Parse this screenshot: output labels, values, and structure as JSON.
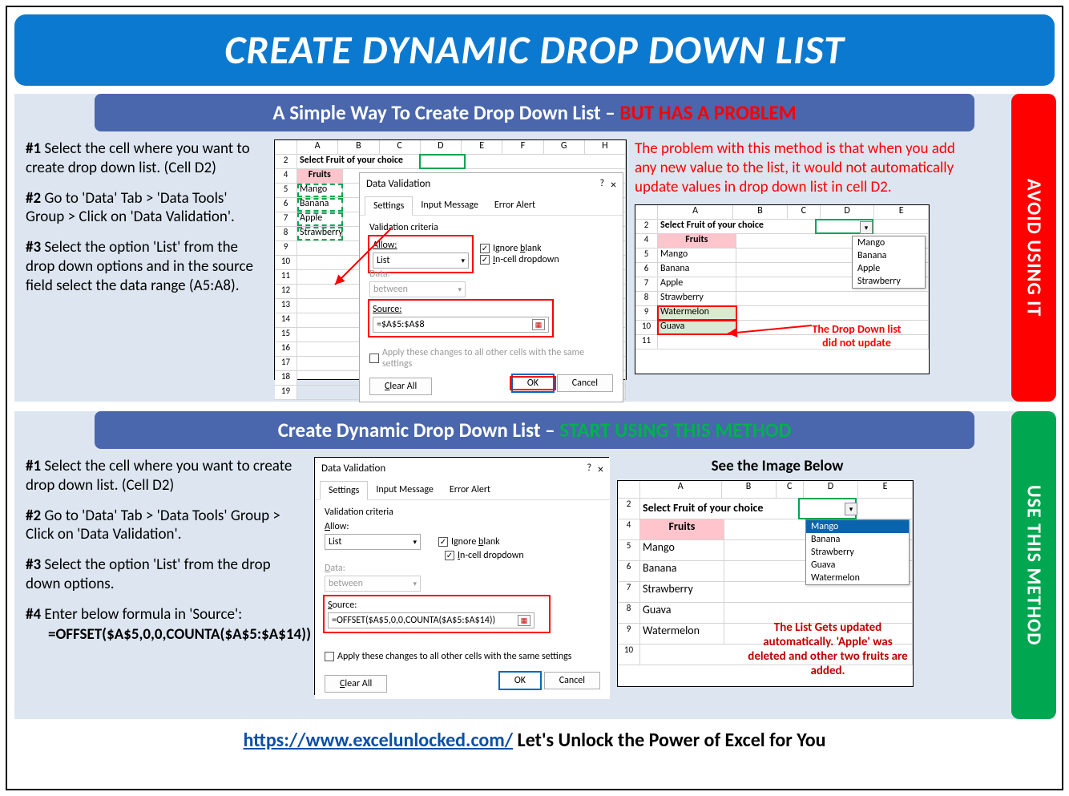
{
  "title": "CREATE DYNAMIC DROP DOWN LIST",
  "section1": {
    "head_a": "A Simple Way To Create Drop Down List – ",
    "head_b": "BUT HAS A PROBLEM",
    "side": "AVOID USING IT",
    "steps": {
      "s1a": "#1",
      "s1b": " Select the cell where you want to create drop down list. (Cell D2)",
      "s2a": "#2",
      "s2b": " Go to 'Data' Tab > 'Data Tools' Group > Click on 'Data Validation'.",
      "s3a": "#3",
      "s3b": " Select the option 'List' from the drop down options and in the source field select the data range (A5:A8)."
    },
    "sheet": {
      "cols": [
        "A",
        "B",
        "C",
        "D",
        "E",
        "F",
        "G",
        "H"
      ],
      "label_row": "2",
      "label": "Select Fruit of your choice",
      "header": "Fruits",
      "items": [
        "Mango",
        "Banana",
        "Apple",
        "Strawberry"
      ]
    },
    "dialog": {
      "title": "Data Validation",
      "tabs": [
        "Settings",
        "Input Message",
        "Error Alert"
      ],
      "criteria_label": "Validation criteria",
      "allow": "Allow:",
      "allow_val": "List",
      "data": "Data:",
      "data_val": "between",
      "source": "Source:",
      "source_val": "=$A$5:$A$8",
      "ignore": "Ignore blank",
      "incell": "In-cell dropdown",
      "apply": "Apply these changes to all other cells with the same settings",
      "clear": "Clear All",
      "ok": "OK",
      "cancel": "Cancel"
    },
    "problem": "The problem with this method is that when you add any new value to the list, it would not automatically update values in drop down list in cell D2.",
    "result": {
      "cols": [
        "A",
        "B",
        "C",
        "D",
        "E"
      ],
      "label": "Select Fruit of your choice",
      "header": "Fruits",
      "items": [
        "Mango",
        "Banana",
        "Apple",
        "Strawberry",
        "Watermelon",
        "Guava"
      ],
      "dd": [
        "Mango",
        "Banana",
        "Apple",
        "Strawberry"
      ],
      "callout1": "The Drop Down list",
      "callout2": "did not update"
    }
  },
  "section2": {
    "head_a": "Create Dynamic Drop Down List – ",
    "head_b": "START USING THIS METHOD",
    "side": "USE THIS METHOD",
    "steps": {
      "s1a": "#1",
      "s1b": " Select the cell where you want to create drop down list. (Cell D2)",
      "s2a": "#2",
      "s2b": " Go to 'Data' Tab > 'Data Tools' Group > Click on 'Data Validation'.",
      "s3a": "#3",
      "s3b": " Select the option 'List' from the drop down options.",
      "s4a": "#4",
      "s4b": " Enter below formula in 'Source':",
      "formula": "=OFFSET($A$5,0,0,COUNTA($A$5:$A$14))"
    },
    "dialog": {
      "title": "Data Validation",
      "tabs": [
        "Settings",
        "Input Message",
        "Error Alert"
      ],
      "criteria_label": "Validation criteria",
      "allow": "Allow:",
      "allow_val": "List",
      "data": "Data:",
      "data_val": "between",
      "source": "Source:",
      "source_val": "=OFFSET($A$5,0,0,COUNTA($A$5:$A$14))",
      "ignore": "Ignore blank",
      "incell": "In-cell dropdown",
      "apply": "Apply these changes to all other cells with the same settings",
      "clear": "Clear All",
      "ok": "OK",
      "cancel": "Cancel"
    },
    "see_label": "See the Image Below",
    "result": {
      "cols": [
        "A",
        "B",
        "C",
        "D",
        "E"
      ],
      "label": "Select Fruit of your choice",
      "header": "Fruits",
      "items": [
        "Mango",
        "Banana",
        "Strawberry",
        "Guava",
        "Watermelon"
      ],
      "dd": [
        "Mango",
        "Banana",
        "Strawberry",
        "Guava",
        "Watermelon"
      ],
      "callout": "The List Gets updated automatically. 'Apple' was deleted and other two fruits are added."
    }
  },
  "footer": {
    "url": "https://www.excelunlocked.com/",
    "text": " Let's Unlock the Power of Excel for You"
  }
}
